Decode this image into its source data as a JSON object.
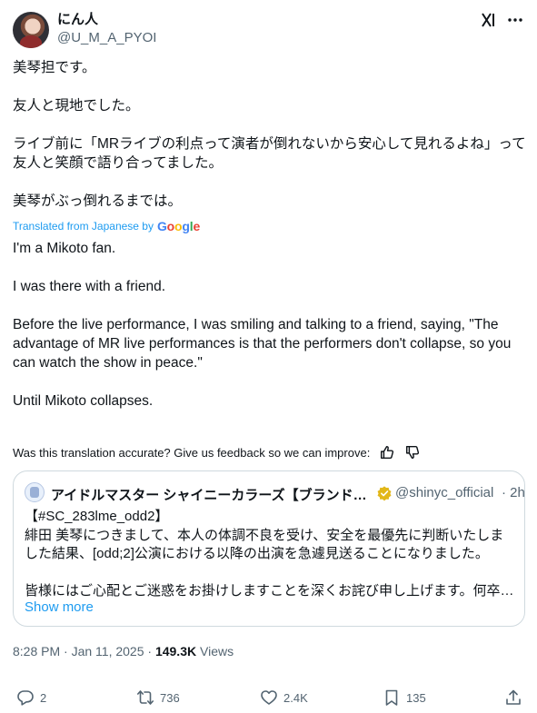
{
  "author": {
    "display_name": "にん人",
    "handle": "@U_M_A_PYOI"
  },
  "tweet": {
    "original_text": "美琴担です。\n\n友人と現地でした。\n\nライブ前に「MRライブの利点って演者が倒れないから安心して見れるよね」って友人と笑顔で語り合ってました。\n\n美琴がぶっ倒れるまでは。",
    "translated_label": "Translated from Japanese by",
    "translation_provider": [
      "G",
      "o",
      "o",
      "g",
      "l",
      "e"
    ],
    "translated_text": "I'm a Mikoto fan.\n\nI was there with a friend.\n\nBefore the live performance, I was smiling and talking to a friend, saying, \"The advantage of MR live performances is that the performers don't collapse, so you can watch the show in peace.\"\n\nUntil Mikoto collapses.",
    "feedback_prompt": "Was this translation accurate? Give us feedback so we can improve:"
  },
  "quoted": {
    "display_name": "アイドルマスター シャイニーカラーズ【ブランド公式】",
    "handle": "@shinyc_official",
    "time": "· 2h",
    "text": "【#SC_283lme_odd2】\n緋田 美琴につきまして、本人の体調不良を受け、安全を最優先に判断いたしました結果、[odd;2]公演における以降の出演を急遽見送ることになりました。\n\n皆様にはご心配とご迷惑をお掛けしますことを深くお詫び申し上げます。何卒…",
    "show_more": "Show more"
  },
  "meta": {
    "timestamp": "8:28 PM · Jan 11, 2025",
    "separator": "·",
    "views_count": "149.3K",
    "views_label": "Views"
  },
  "actions": {
    "replies": "2",
    "retweets": "736",
    "likes": "2.4K",
    "bookmarks": "135"
  },
  "icons": [
    "grok-icon",
    "more-icon",
    "verified-badge-icon",
    "thumbs-up-icon",
    "thumbs-down-icon",
    "reply-icon",
    "retweet-icon",
    "like-icon",
    "bookmark-icon",
    "share-icon"
  ],
  "colors": {
    "link": "#1d9bf0",
    "muted": "#536471",
    "text": "#0f1419",
    "border": "#cfd9de",
    "verified_gold": "#e2b719"
  }
}
